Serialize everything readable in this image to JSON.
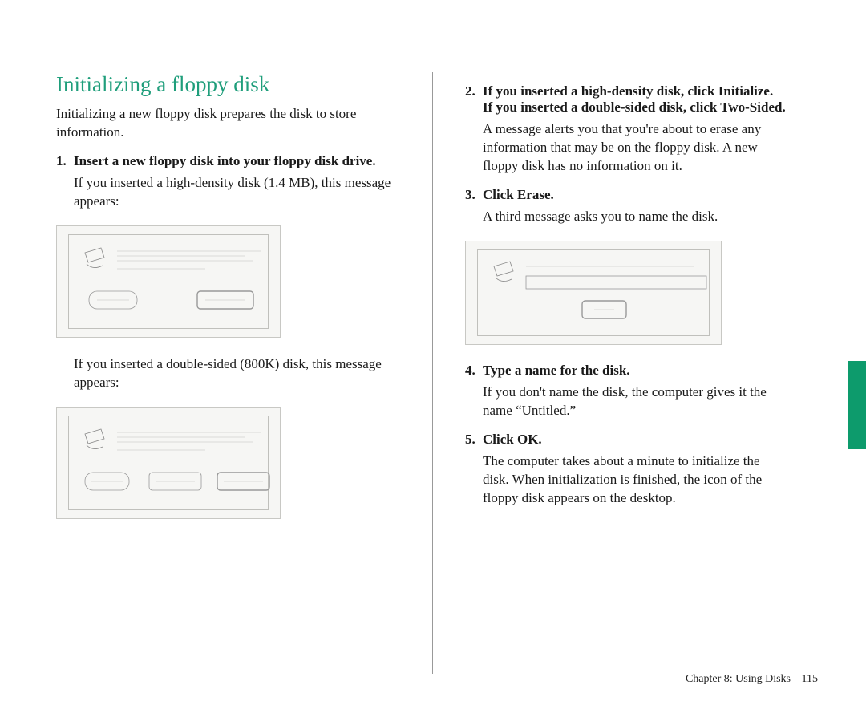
{
  "section_title": "Initializing a floppy disk",
  "intro": "Initializing a new floppy disk prepares the disk to store information.",
  "left": {
    "step1_num": "1.",
    "step1_text": "Insert a new floppy disk into your floppy disk drive.",
    "after1a": "If you inserted a high-density disk (1.4 MB), this message appears:",
    "after1b": "If you inserted a double-sided (800K) disk, this message appears:"
  },
  "right": {
    "step2_num": "2.",
    "step2_text_a": "If you inserted a high-density disk, click Initialize.",
    "step2_text_b": "If you inserted a double-sided disk, click Two-Sided.",
    "after2": "A message alerts you that you're about to erase any information that may be on the floppy disk. A new floppy disk has no information on it.",
    "step3_num": "3.",
    "step3_text": "Click Erase.",
    "after3": "A third message asks you to name the disk.",
    "step4_num": "4.",
    "step4_text": "Type a name for the disk.",
    "after4": "If you don't name the disk, the computer gives it the name “Untitled.”",
    "step5_num": "5.",
    "step5_text": "Click OK.",
    "after5": "The computer takes about a minute to initialize the disk. When initialization is finished, the icon of the floppy disk appears on the desktop."
  },
  "footer": {
    "chapter": "Chapter 8: Using Disks",
    "page": "115"
  },
  "colors": {
    "heading": "#1f9e7b",
    "tab": "#0d9b6c"
  }
}
